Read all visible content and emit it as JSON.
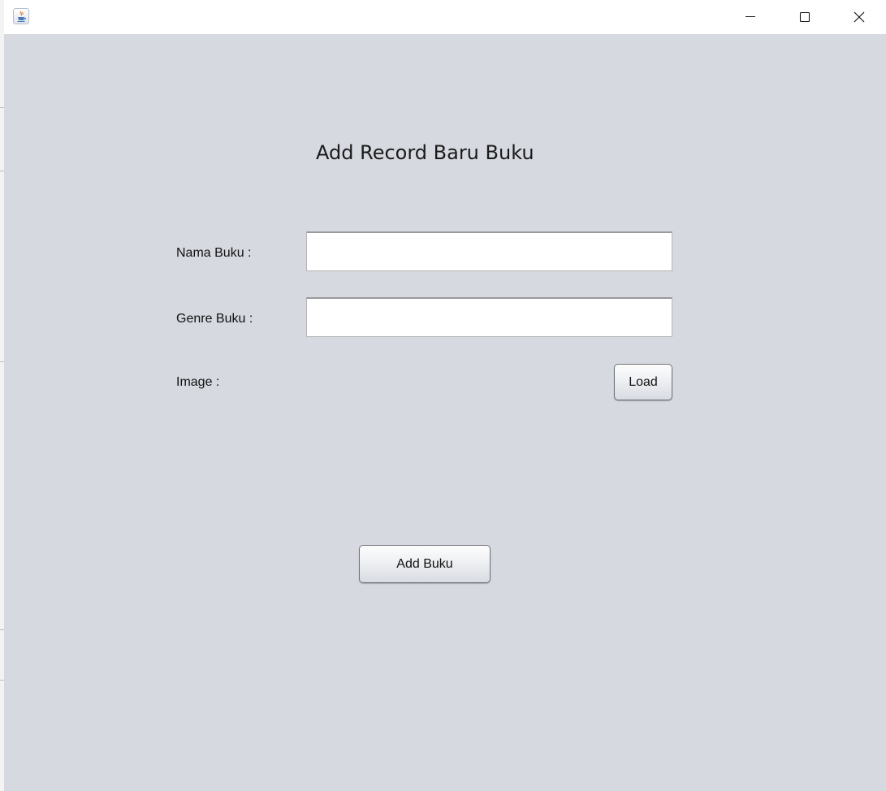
{
  "window": {
    "title": "",
    "icon": "java-cup-icon",
    "controls": [
      "minimize-icon",
      "maximize-icon",
      "close-icon"
    ]
  },
  "form": {
    "heading": "Add Record Baru Buku",
    "nama_label": "Nama Buku :",
    "nama_value": "",
    "genre_label": "Genre Buku :",
    "genre_value": "",
    "image_label": "Image :",
    "load_button": "Load",
    "add_button": "Add Buku"
  },
  "colors": {
    "panel_background": "#d6d9e0",
    "titlebar": "#ffffff"
  }
}
